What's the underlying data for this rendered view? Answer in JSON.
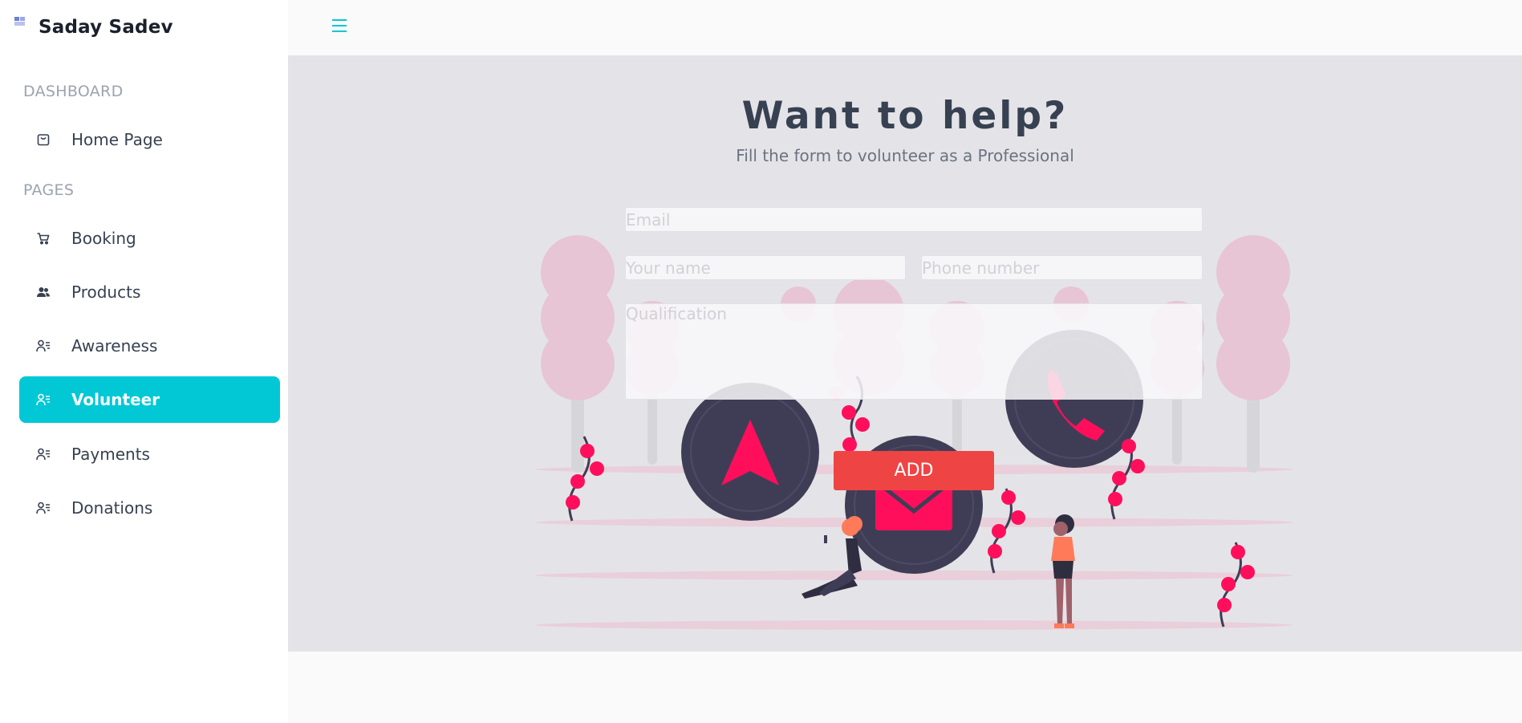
{
  "brand": {
    "name": "Saday Sadev",
    "logo_icon": "app-logo-icon"
  },
  "sidebar": {
    "sections": [
      {
        "label": "DASHBOARD"
      },
      {
        "label": "PAGES"
      }
    ],
    "items": [
      {
        "label": "Home Page",
        "icon": "bag-icon"
      },
      {
        "label": "Booking",
        "icon": "cart-icon"
      },
      {
        "label": "Products",
        "icon": "users-icon"
      },
      {
        "label": "Awareness",
        "icon": "user-list-icon"
      },
      {
        "label": "Volunteer",
        "icon": "user-list-icon",
        "active": true
      },
      {
        "label": "Payments",
        "icon": "user-list-icon"
      },
      {
        "label": "Donations",
        "icon": "user-list-icon"
      }
    ],
    "active_color": "#02c8d6"
  },
  "topbar": {
    "menu_icon": "hamburger-icon",
    "accent": "#02c8d6"
  },
  "main": {
    "title": "Want to help?",
    "subtitle": "Fill the form to volunteer as a Professional",
    "form": {
      "email_placeholder": "Email",
      "name_placeholder": "Your name",
      "phone_placeholder": "Phone number",
      "qualification_placeholder": "Qualification",
      "submit_label": "ADD"
    },
    "button_color": "#ef4444"
  }
}
